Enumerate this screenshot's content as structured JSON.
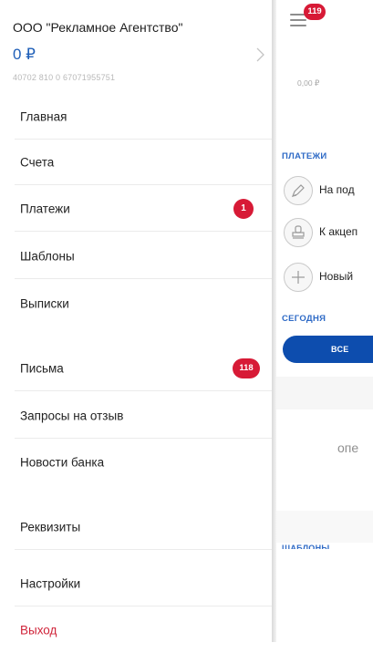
{
  "drawer": {
    "company_name": "ООО \"Рекламное Агентство\"",
    "balance": "0 ₽",
    "account_number": "40702 810 0 67071955751",
    "items": [
      {
        "label": "Главная"
      },
      {
        "label": "Счета"
      },
      {
        "label": "Платежи",
        "badge": "1"
      },
      {
        "label": "Шаблоны"
      },
      {
        "label": "Выписки"
      },
      {
        "label": "Письма",
        "badge": "118"
      },
      {
        "label": "Запросы на отзыв"
      },
      {
        "label": "Новости банка"
      },
      {
        "label": "Реквизиты"
      },
      {
        "label": "Настройки"
      },
      {
        "label": "Выход"
      }
    ]
  },
  "background": {
    "notifications_badge": "119",
    "amount": "0,00 ₽",
    "payments_section": "ПЛАТЕЖИ",
    "rows": [
      {
        "label": "На под",
        "icon": "pen-icon"
      },
      {
        "label": "К акцеп",
        "icon": "stamp-icon"
      },
      {
        "label": "Новый",
        "icon": "plus-icon"
      }
    ],
    "today_section": "СЕГОДНЯ",
    "filter_all": "ВСЕ",
    "partial_text": "опе",
    "templates_section": "ШАБЛОНЫ"
  },
  "colors": {
    "accent": "#1f5fb8",
    "badge": "#d71a36",
    "logout": "#d0243a",
    "pill": "#0d4dae"
  }
}
